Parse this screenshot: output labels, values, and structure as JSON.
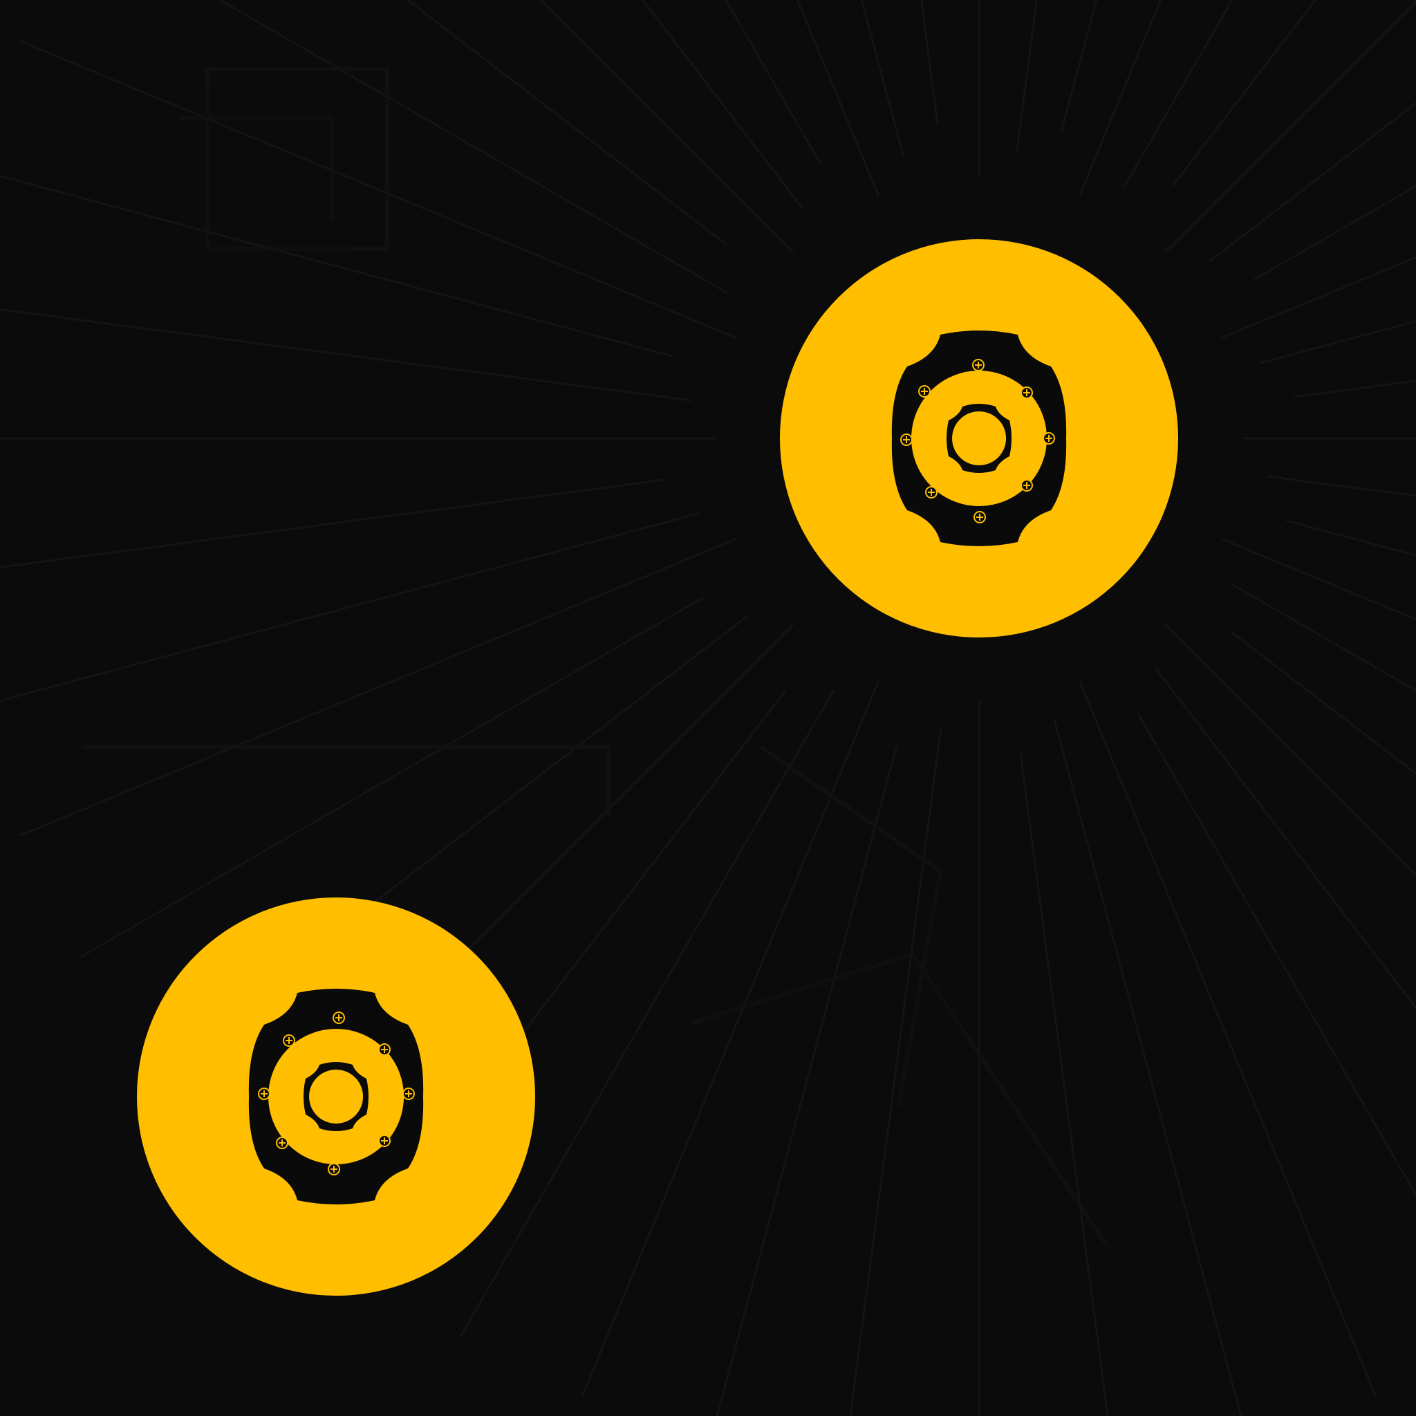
{
  "scene": {
    "background_color": "#0b0b0b",
    "ray_color": "#141414",
    "accent_color": "#ffbf00",
    "mark_color": "#0a0a0a"
  },
  "emblems": [
    {
      "id": "upper-right",
      "icon": "wheel-hub-icon",
      "screw_count": 8
    },
    {
      "id": "lower-left",
      "icon": "wheel-hub-icon",
      "screw_count": 8
    }
  ]
}
